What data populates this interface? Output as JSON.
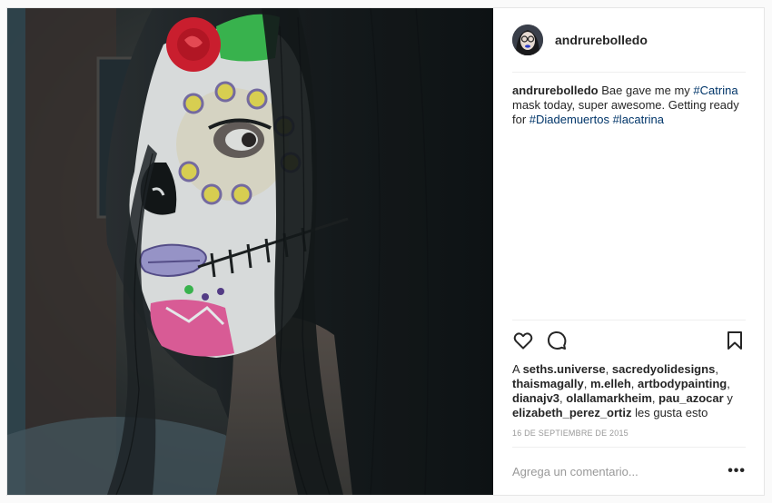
{
  "post": {
    "username": "andrurebolledo",
    "caption": {
      "user": "andrurebolledo",
      "t1": " Bae gave me my ",
      "tag1": "#Catrina",
      "t2": " mask today, super awesome. Getting ready for ",
      "tag2": "#Diademuertos",
      "t3": " ",
      "tag3": "#lacatrina"
    },
    "likes": {
      "prefix": "A ",
      "users": [
        "seths.universe",
        "sacredyolidesigns",
        "thaismagally",
        "m.elleh",
        "artbodypainting",
        "dianajv3",
        "olallamarkheim",
        "pau_azocar",
        "elizabeth_perez_ortiz"
      ],
      "sep": ", ",
      "and": " y",
      "suffix": " les gusta esto"
    },
    "date": "16 DE SEPTIEMBRE DE 2015",
    "comment_placeholder": "Agrega un comentario...",
    "more_label": "•••"
  },
  "icons": {
    "like": "heart-icon",
    "comment": "comment-bubble-icon",
    "save": "bookmark-icon",
    "more": "more-options-icon"
  },
  "colors": {
    "link": "#003569",
    "muted": "#999999",
    "border": "#efefef"
  }
}
